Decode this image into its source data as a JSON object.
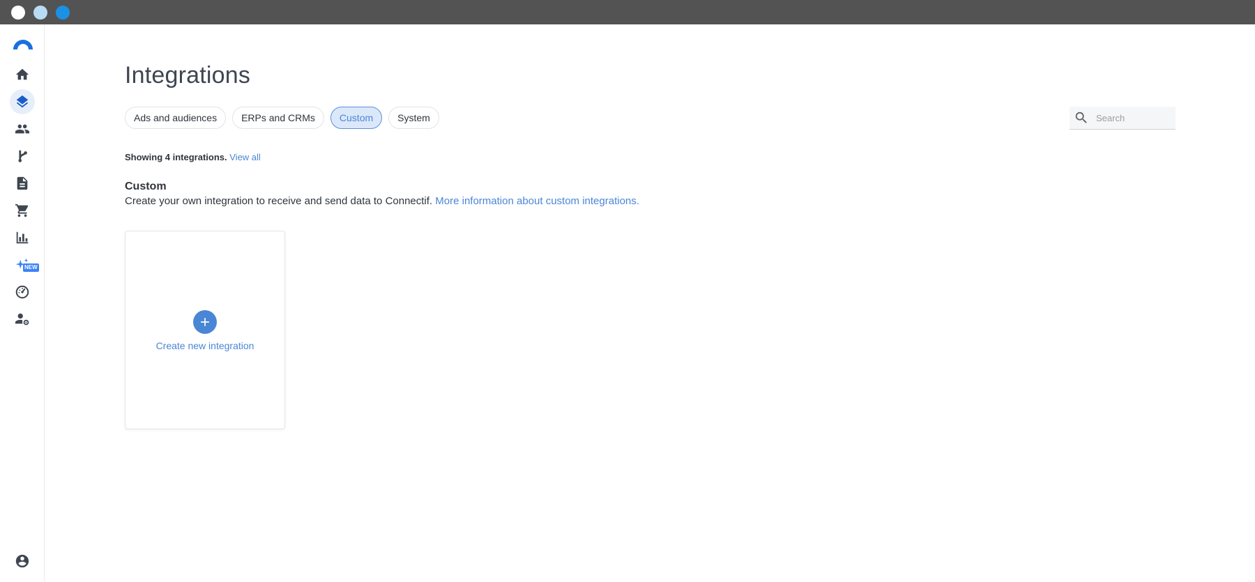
{
  "window": {
    "controls": [
      "close",
      "minimize",
      "maximize"
    ]
  },
  "sidebar": {
    "logo": "brand-arc-logo",
    "items": [
      {
        "name": "home",
        "icon": "home-icon",
        "active": false
      },
      {
        "name": "integrations",
        "icon": "layers-icon",
        "active": true
      },
      {
        "name": "audiences",
        "icon": "people-icon",
        "active": false
      },
      {
        "name": "flows",
        "icon": "branch-icon",
        "active": false
      },
      {
        "name": "documents",
        "icon": "document-icon",
        "active": false
      },
      {
        "name": "commerce",
        "icon": "cart-icon",
        "active": false
      },
      {
        "name": "analytics",
        "icon": "bar-chart-icon",
        "active": false
      },
      {
        "name": "ai",
        "icon": "sparkles-icon",
        "active": false,
        "badge": "NEW"
      },
      {
        "name": "dashboard",
        "icon": "gauge-icon",
        "active": false
      },
      {
        "name": "user-settings",
        "icon": "user-gear-icon",
        "active": false
      }
    ],
    "account_icon": "account-circle-icon"
  },
  "main": {
    "title": "Integrations",
    "tabs": [
      {
        "label": "Ads and audiences",
        "selected": false
      },
      {
        "label": "ERPs and CRMs",
        "selected": false
      },
      {
        "label": "Custom",
        "selected": true
      },
      {
        "label": "System",
        "selected": false
      }
    ],
    "search": {
      "placeholder": "Search",
      "value": ""
    },
    "showing_text": "Showing 4 integrations.",
    "view_all": "View all",
    "section": {
      "title": "Custom",
      "description": "Create your own integration to receive and send data to Connectif.",
      "link": "More information about custom integrations."
    },
    "create_card": {
      "label": "Create new integration"
    }
  },
  "colors": {
    "accent": "#4a86d6",
    "selected_tab_bg": "#dbe8fa",
    "titlebar": "#535353",
    "text": "#2f353b"
  }
}
